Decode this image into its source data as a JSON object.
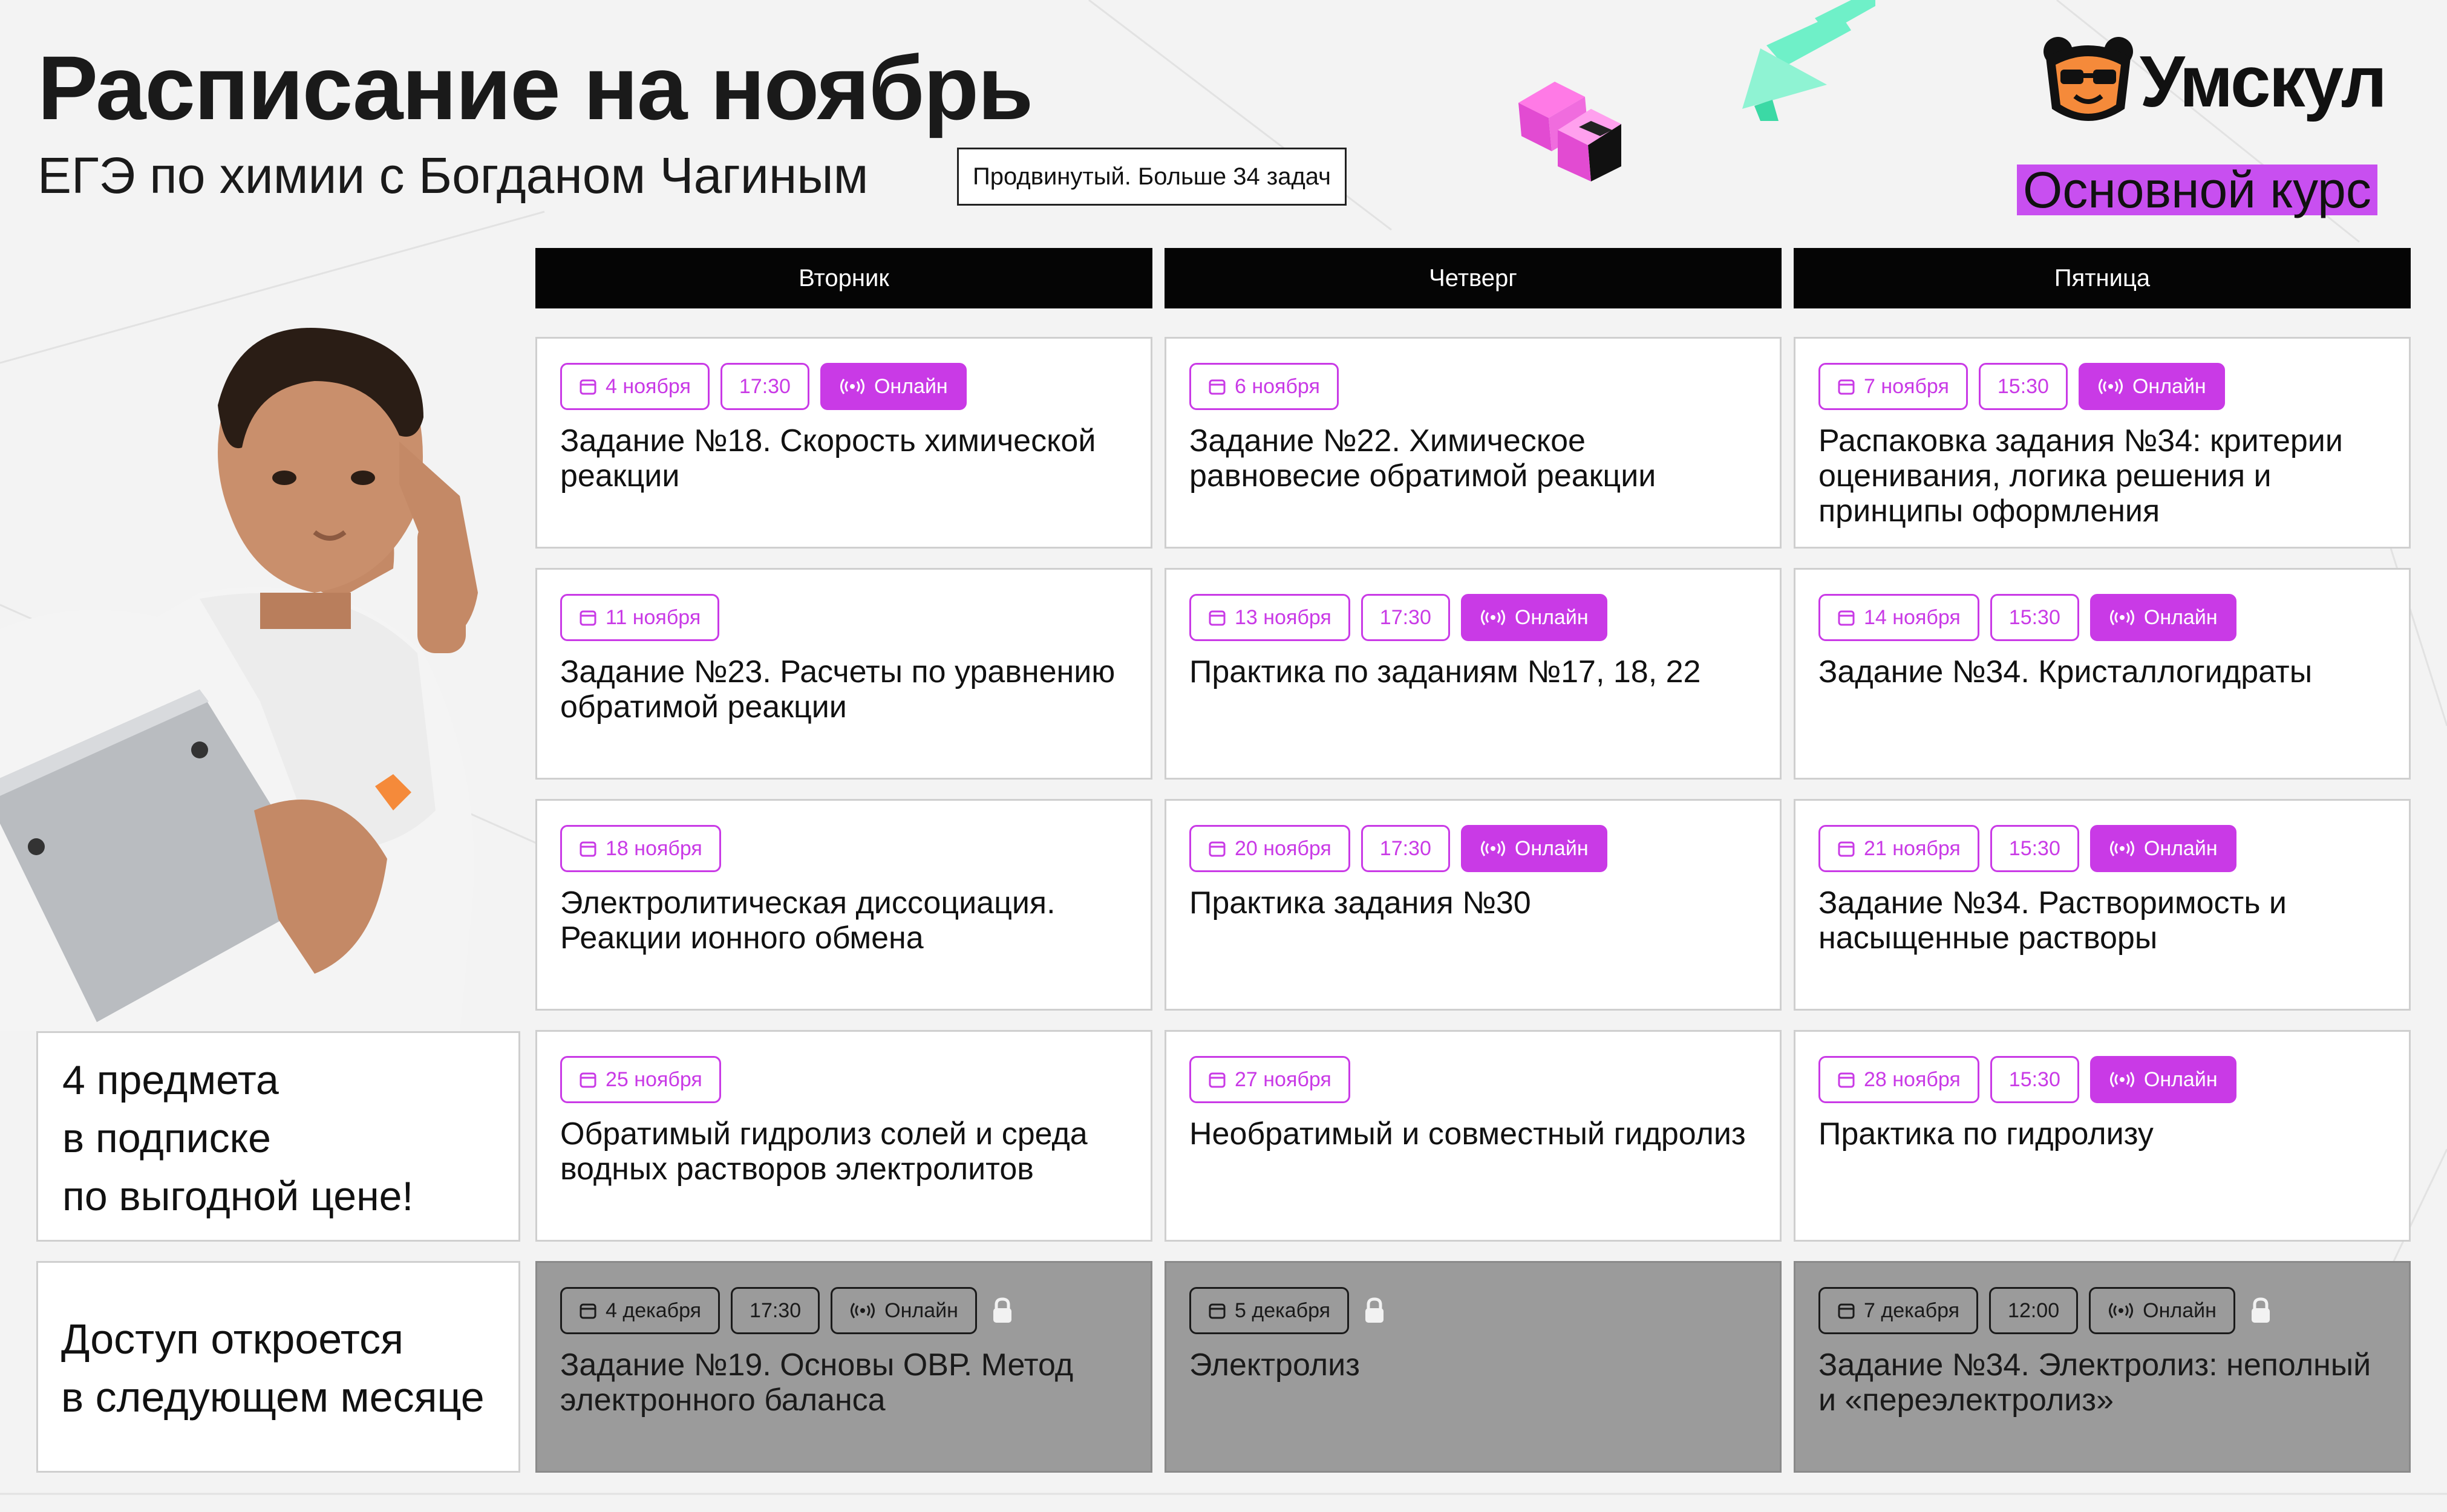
{
  "header": {
    "title": "Расписание на ноябрь",
    "subtitle": "ЕГЭ по химии с Богданом Чагиным",
    "level_badge": "Продвинутый. Больше 34 задач"
  },
  "brand": {
    "logo_text": "Умскул",
    "course_tag": "Основной курс",
    "accent_color": "#c93ae6",
    "tag_color": "#c84ff0",
    "icon": "bear-icon"
  },
  "days": [
    "Вторник",
    "Четверг",
    "Пятница"
  ],
  "lessons": [
    {
      "day": "Вторник",
      "date": "4 ноября",
      "time": "17:30",
      "online": "Онлайн",
      "title": "Задание №18. Скорость химической реакции"
    },
    {
      "day": "Четверг",
      "date": "6 ноября",
      "time": "",
      "online": "",
      "title": "Задание №22. Химическое равновесие обратимой реакции"
    },
    {
      "day": "Пятница",
      "date": "7 ноября",
      "time": "15:30",
      "online": "Онлайн",
      "title": "Распаковка задания №34: критерии оценивания, логика решения и принципы оформления"
    },
    {
      "day": "Вторник",
      "date": "11 ноября",
      "time": "",
      "online": "",
      "title": "Задание №23. Расчеты по уравнению обратимой реакции"
    },
    {
      "day": "Четверг",
      "date": "13 ноября",
      "time": "17:30",
      "online": "Онлайн",
      "title": "Практика по заданиям №17, 18, 22"
    },
    {
      "day": "Пятница",
      "date": "14 ноября",
      "time": "15:30",
      "online": "Онлайн",
      "title": "Задание №34. Кристаллогидраты"
    },
    {
      "day": "Вторник",
      "date": "18 ноября",
      "time": "",
      "online": "",
      "title": "Электролитическая диссоциация. Реакции ионного обмена"
    },
    {
      "day": "Четверг",
      "date": "20 ноября",
      "time": "17:30",
      "online": "Онлайн",
      "title": "Практика задания №30"
    },
    {
      "day": "Пятница",
      "date": "21 ноября",
      "time": "15:30",
      "online": "Онлайн",
      "title": "Задание №34. Растворимость и насыщенные растворы"
    },
    {
      "day": "Вторник",
      "date": "25 ноября",
      "time": "",
      "online": "",
      "title": "Обратимый гидролиз солей и среда водных растворов электролитов"
    },
    {
      "day": "Четверг",
      "date": "27 ноября",
      "time": "",
      "online": "",
      "title": "Необратимый и совместный гидролиз"
    },
    {
      "day": "Пятница",
      "date": "28 ноября",
      "time": "15:30",
      "online": "Онлайн",
      "title": "Практика по гидролизу"
    },
    {
      "day": "Вторник",
      "date": "4 декабря",
      "time": "17:30",
      "online": "Онлайн",
      "title": "Задание №19. Основы ОВР. Метод электронного баланса",
      "locked": true
    },
    {
      "day": "Четверг",
      "date": "5 декабря",
      "time": "",
      "online": "",
      "title": "Электролиз",
      "locked": true
    },
    {
      "day": "Пятница",
      "date": "7 декабря",
      "time": "12:00",
      "online": "Онлайн",
      "title": "Задание №34. Электролиз: неполный и «переэлектролиз»",
      "locked": true
    }
  ],
  "promo": {
    "line1": "4 предмета",
    "line2": "в подписке",
    "line3": "по выгодной цене!"
  },
  "access_notice": {
    "line1": "Доступ откроется",
    "line2": "в следующем месяце"
  }
}
